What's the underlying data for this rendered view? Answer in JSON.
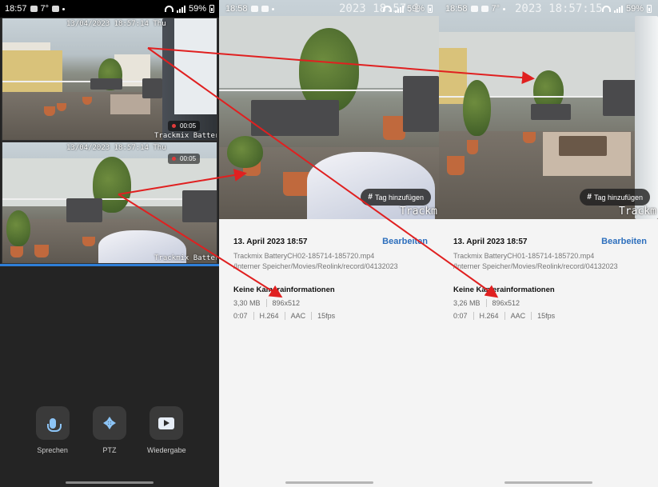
{
  "screen1": {
    "status": {
      "time": "18:57",
      "temp": "7°",
      "battery": "59%"
    },
    "cam_top": {
      "timestamp": "13/04/2023 18:57:14 Thu",
      "name": "Trackmix Battery",
      "rec_time": "00:05"
    },
    "cam_bottom": {
      "timestamp": "13/04/2023 18:57:14 Thu",
      "name": "Trackmix Battery",
      "rec_time": "00:05"
    },
    "actions": [
      {
        "label": "Sprechen",
        "icon": "microphone-icon"
      },
      {
        "label": "PTZ",
        "icon": "ptz-arrows-icon"
      },
      {
        "label": "Wiedergabe",
        "icon": "playback-icon"
      }
    ]
  },
  "screen2": {
    "status": {
      "time": "18:58",
      "battery": "59%"
    },
    "overlay_date": "2023 18:57:1",
    "overlay_cam": "Trackm",
    "tag_button": "Tag hinzufügen",
    "date": "13. April 2023 18:57",
    "edit": "Bearbeiten",
    "filename": "Trackmix BatteryCH02-185714-185720.mp4",
    "path": "/Interner Speicher/Movies/Reolink/record/04132023",
    "camera_info": "Keine Kamerainformationen",
    "size": "3,30 MB",
    "resolution": "896x512",
    "duration": "0:07",
    "codec": "H.264",
    "audio": "AAC",
    "fps": "15fps"
  },
  "screen3": {
    "status": {
      "time": "18:58",
      "temp": "7°",
      "battery": "59%"
    },
    "overlay_date": "2023 18:57:15",
    "overlay_cam": "Trackm",
    "tag_button": "Tag hinzufügen",
    "date": "13. April 2023 18:57",
    "edit": "Bearbeiten",
    "filename": "Trackmix BatteryCH01-185714-185720.mp4",
    "path": "/Interner Speicher/Movies/Reolink/record/04132023",
    "camera_info": "Keine Kamerainformationen",
    "size": "3,26 MB",
    "resolution": "896x512",
    "duration": "0:07",
    "codec": "H.264",
    "audio": "AAC",
    "fps": "15fps"
  },
  "colors": {
    "arrow": "#e02020",
    "accent": "#2d6fbd",
    "live_bar": "#2f7fd8"
  }
}
